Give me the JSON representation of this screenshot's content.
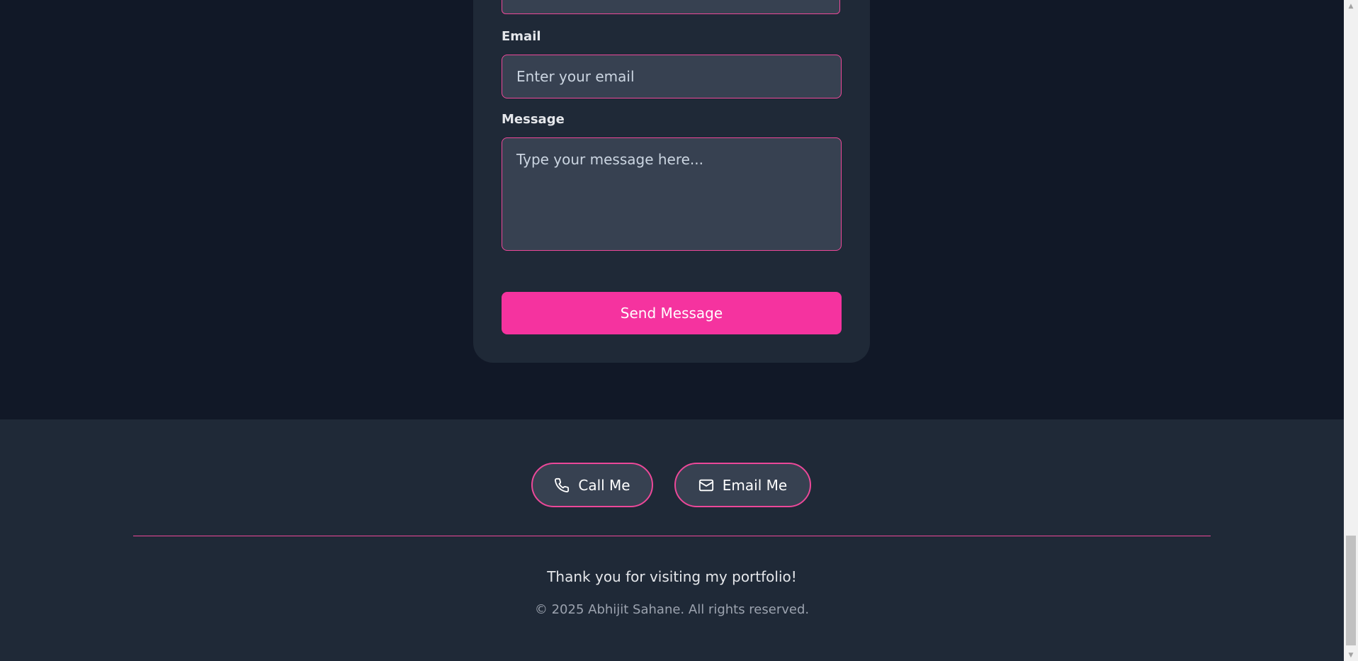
{
  "contact_form": {
    "email": {
      "label": "Email",
      "placeholder": "Enter your email",
      "value": ""
    },
    "message": {
      "label": "Message",
      "placeholder": "Type your message here...",
      "value": ""
    },
    "send_label": "Send Message"
  },
  "footer": {
    "call_label": "Call Me",
    "email_label": "Email Me",
    "thanks_text": "Thank you for visiting my portfolio!",
    "copyright_text": "© 2025 Abhijit Sahane. All rights reserved."
  },
  "colors": {
    "page_background": "#111827",
    "card_background": "#1f2937",
    "input_background": "#374151",
    "accent_pink": "#f5339f",
    "border_pink": "#ec4899"
  },
  "icons": {
    "call": "phone-icon",
    "email": "mail-icon"
  }
}
